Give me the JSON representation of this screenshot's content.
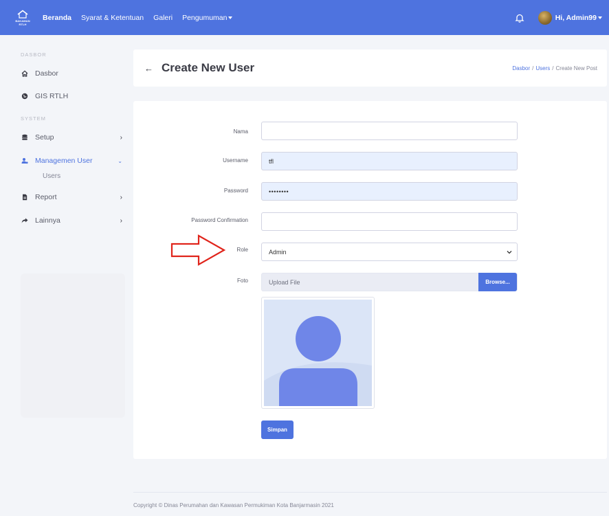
{
  "navbar": {
    "brand_text_1": "BAKAMAN",
    "brand_text_2": "RTLH",
    "links": [
      "Beranda",
      "Syarat & Ketentuan",
      "Galeri",
      "Pengumuman"
    ],
    "user_label": "Hi, Admin99",
    "accent": "#4e73df"
  },
  "sidebar": {
    "heading_dasbor": "DASBOR",
    "item_dasbor": "Dasbor",
    "item_gis": "GIS RTLH",
    "heading_system": "SYSTEM",
    "item_setup": "Setup",
    "item_managemen": "Managemen User",
    "sub_users": "Users",
    "item_report": "Report",
    "item_lainnya": "Lainnya"
  },
  "header": {
    "back_icon": "arrow-left-icon",
    "title": "Create New User",
    "breadcrumb": [
      "Dasbor",
      "Users",
      "Create New Post"
    ],
    "breadcrumb_sep": "/"
  },
  "form": {
    "nama_label": "Nama",
    "nama_value": "",
    "username_label": "Username",
    "username_value": "tfl",
    "password_label": "Password",
    "password_value": "••••••••",
    "password_confirm_label": "Password Confirmation",
    "password_confirm_value": "",
    "role_label": "Role",
    "role_value": "Admin",
    "foto_label": "Foto",
    "upload_placeholder": "Upload File",
    "browse_label": "Browse...",
    "submit_label": "Simpan"
  },
  "footer": {
    "copyright": "Copyright © Dinas Perumahan dan Kawasan Permukiman Kota Banjarmasin 2021"
  }
}
